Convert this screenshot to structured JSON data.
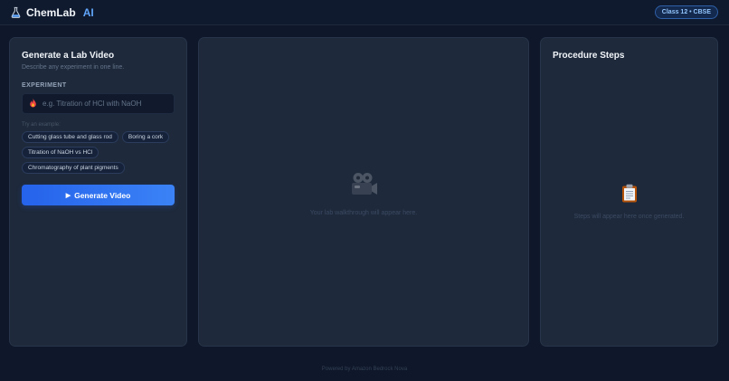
{
  "header": {
    "brand_name": "ChemLab",
    "brand_accent": "AI",
    "badge": "Class 12 • CBSE"
  },
  "left_panel": {
    "title": "Generate a Lab Video",
    "subtitle": "Describe any experiment in one line.",
    "field_label": "EXPERIMENT",
    "input_value": "",
    "input_placeholder": "e.g. Titration of HCl with NaOH",
    "examples_label": "Try an example:",
    "examples": [
      "Cutting glass tube and glass rod",
      "Boring a cork",
      "Titration of NaOH vs HCl",
      "Chromatography of plant pigments"
    ],
    "generate_label": "Generate Video"
  },
  "video_panel": {
    "placeholder": "Your lab walkthrough will appear here."
  },
  "steps_panel": {
    "title": "Procedure Steps",
    "placeholder": "Steps will appear here once generated."
  },
  "footer": {
    "text": "Powered by Amazon Bedrock Nova"
  },
  "icons": {
    "brand": "flask-icon",
    "input": "flame-icon",
    "video": "movie-camera-icon",
    "steps": "clipboard-icon"
  },
  "colors": {
    "accent": "#60a5fa",
    "button": "#2563eb",
    "background": "#0f172a",
    "panel": "#1e293b"
  }
}
